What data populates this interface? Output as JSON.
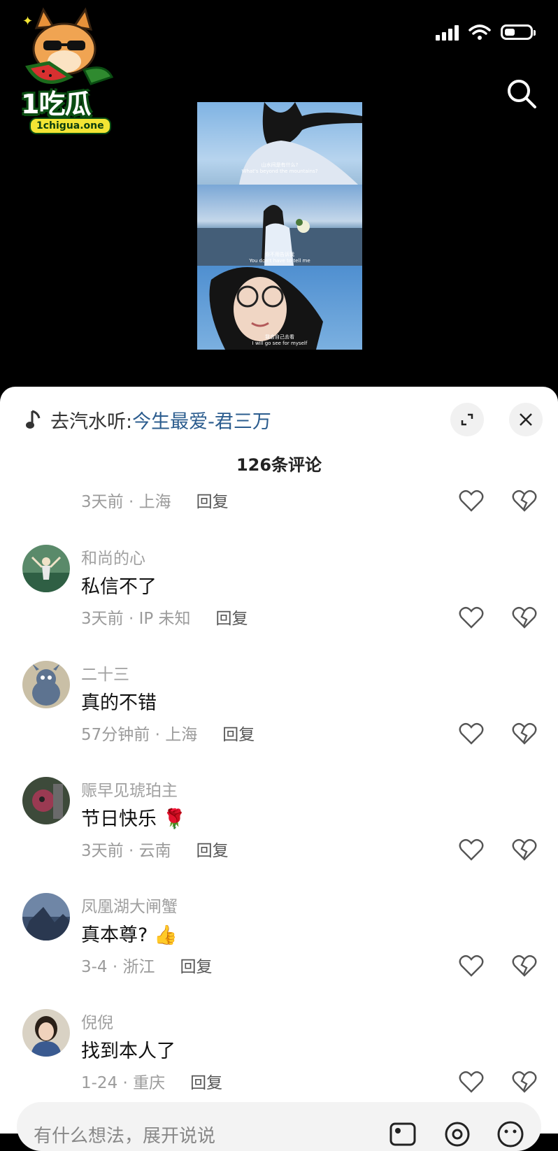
{
  "watermark": {
    "brand": "1吃瓜",
    "site": "1chigua.one"
  },
  "video": {
    "captions": [
      {
        "zh": "山水间是有什么?",
        "en": "What's beyond the mountains?"
      },
      {
        "zh": "你不用告诉我",
        "en": "You don't have to tell me"
      },
      {
        "zh": "我会自己去看",
        "en": "I will go see for myself"
      }
    ]
  },
  "sheet": {
    "music_prefix": "去汽水听:",
    "music_title": "今生最爱-君三万",
    "comment_count_label": "126条评论"
  },
  "first_meta": {
    "time": "3天前 · 上海",
    "reply": "回复"
  },
  "comments": [
    {
      "name": "和尚的心",
      "text": "私信不了",
      "meta": "3天前 · IP 未知",
      "reply": "回复",
      "emoji": ""
    },
    {
      "name": "二十三",
      "text": "真的不错",
      "meta": "57分钟前 · 上海",
      "reply": "回复",
      "emoji": ""
    },
    {
      "name": "赈早见琥珀主",
      "text": "节日快乐",
      "meta": "3天前 · 云南",
      "reply": "回复",
      "emoji": "🌹"
    },
    {
      "name": "凤凰湖大闸蟹",
      "text": "真本尊?",
      "meta": "3-4 · 浙江",
      "reply": "回复",
      "emoji": "👍"
    },
    {
      "name": "倪倪",
      "text": "找到本人了",
      "meta": "1-24 · 重庆",
      "reply": "回复",
      "emoji": ""
    }
  ],
  "input": {
    "placeholder": "有什么想法，展开说说"
  },
  "icons": [
    "signal-icon",
    "wifi-icon",
    "battery-icon",
    "search-icon",
    "music-note-icon",
    "expand-icon",
    "close-icon",
    "heart-icon",
    "broken-heart-icon",
    "image-icon",
    "at-icon",
    "emoji-icon"
  ]
}
